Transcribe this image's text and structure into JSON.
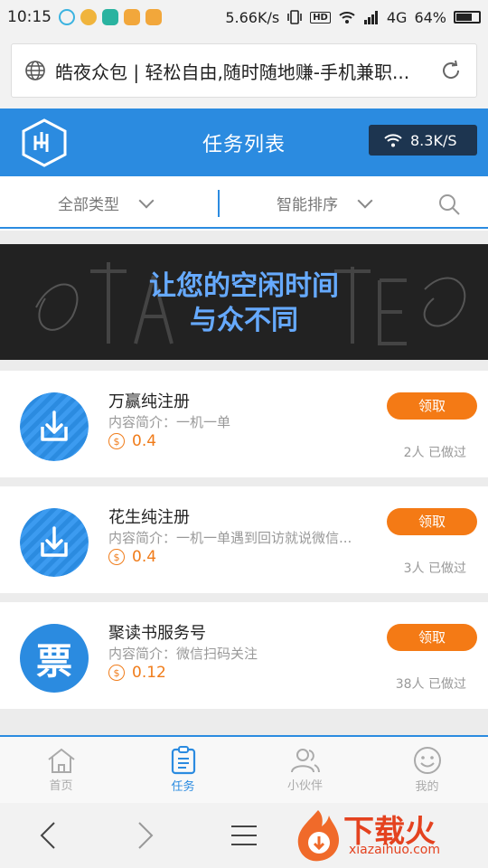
{
  "status_bar": {
    "time": "10:15",
    "network_speed": "5.66K/s",
    "hd": "HD",
    "network_type": "4G",
    "battery": "64%",
    "battery_level": 0.64
  },
  "browser": {
    "url_title": "皓夜众包 | 轻松自由,随时随地赚-手机兼职..."
  },
  "header": {
    "title": "任务列表",
    "speed": "8.3K/S",
    "brand_color": "#2b8be0"
  },
  "filters": {
    "type_label": "全部类型",
    "sort_label": "智能排序"
  },
  "banner": {
    "line1": "让您的空闲时间",
    "line2": "与众不同"
  },
  "tasks": [
    {
      "title": "万赢纯注册",
      "desc": "内容简介：一机一单",
      "reward": "0.4",
      "button": "领取",
      "done": "2人 已做过",
      "icon": "download-icon"
    },
    {
      "title": "花生纯注册",
      "desc": "内容简介：一机一单遇到回访就说微信...",
      "reward": "0.4",
      "button": "领取",
      "done": "3人 已做过",
      "icon": "download-icon"
    },
    {
      "title": "聚读书服务号",
      "desc": "内容简介：微信扫码关注",
      "reward": "0.12",
      "button": "领取",
      "done": "38人 已做过",
      "icon_char": "票"
    }
  ],
  "tabs": [
    {
      "label": "首页",
      "icon": "home-icon"
    },
    {
      "label": "任务",
      "icon": "task-list-icon",
      "active": true
    },
    {
      "label": "小伙伴",
      "icon": "friends-icon"
    },
    {
      "label": "我的",
      "icon": "smile-icon"
    }
  ],
  "watermark": {
    "title": "下载火",
    "url": "xiazaihuo.com"
  }
}
